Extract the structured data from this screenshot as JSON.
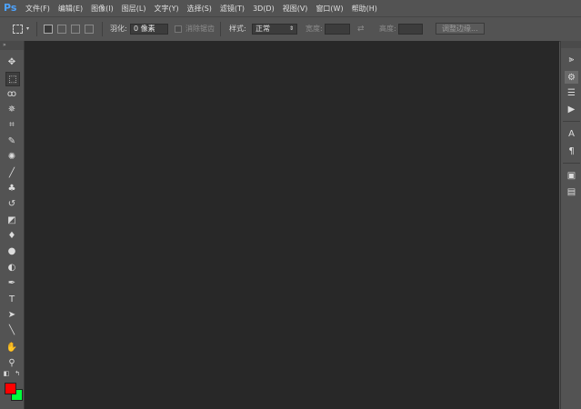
{
  "app": {
    "logo": "Ps"
  },
  "menu": [
    "文件(F)",
    "编辑(E)",
    "图像(I)",
    "图层(L)",
    "文字(Y)",
    "选择(S)",
    "滤镜(T)",
    "3D(D)",
    "视图(V)",
    "窗口(W)",
    "帮助(H)"
  ],
  "options": {
    "feather_label": "羽化:",
    "feather_value": "0 像素",
    "antialias_label": "消除锯齿",
    "style_label": "样式:",
    "style_value": "正常",
    "width_label": "宽度:",
    "height_label": "高度:",
    "refine_edge": "调整边缘..."
  },
  "tools": [
    {
      "name": "move-tool-icon",
      "glyph": "✥"
    },
    {
      "name": "rect-marquee-tool-icon",
      "glyph": "⬚"
    },
    {
      "name": "lasso-tool-icon",
      "glyph": "ꝏ"
    },
    {
      "name": "quick-select-tool-icon",
      "glyph": "✵"
    },
    {
      "name": "crop-tool-icon",
      "glyph": "⌗"
    },
    {
      "name": "eyedropper-tool-icon",
      "glyph": "✎"
    },
    {
      "name": "spot-heal-tool-icon",
      "glyph": "✺"
    },
    {
      "name": "brush-tool-icon",
      "glyph": "╱"
    },
    {
      "name": "clone-stamp-tool-icon",
      "glyph": "♣"
    },
    {
      "name": "history-brush-tool-icon",
      "glyph": "↺"
    },
    {
      "name": "eraser-tool-icon",
      "glyph": "◩"
    },
    {
      "name": "paint-bucket-tool-icon",
      "glyph": "♦"
    },
    {
      "name": "blur-tool-icon",
      "glyph": "●"
    },
    {
      "name": "dodge-tool-icon",
      "glyph": "◐"
    },
    {
      "name": "pen-tool-icon",
      "glyph": "✒"
    },
    {
      "name": "type-tool-icon",
      "glyph": "T"
    },
    {
      "name": "path-select-tool-icon",
      "glyph": "➤"
    },
    {
      "name": "line-tool-icon",
      "glyph": "╲"
    },
    {
      "name": "hand-tool-icon",
      "glyph": "✋"
    },
    {
      "name": "zoom-tool-icon",
      "glyph": "⚲"
    }
  ],
  "colors": {
    "foreground": "#ff0000",
    "background": "#00ff3c",
    "canvas": "#282828",
    "chrome": "#535353"
  },
  "right_panel": [
    {
      "name": "history-panel-icon",
      "glyph": "⫸"
    },
    {
      "name": "adjustments-panel-icon",
      "glyph": "⚙"
    },
    {
      "name": "properties-panel-icon",
      "glyph": "☰"
    },
    {
      "name": "actions-panel-icon",
      "glyph": "▶"
    },
    {
      "name": "character-panel-icon",
      "glyph": "A"
    },
    {
      "name": "paragraph-panel-icon",
      "glyph": "¶"
    },
    {
      "name": "layers-panel-icon",
      "glyph": "▣"
    },
    {
      "name": "notes-panel-icon",
      "glyph": "▤"
    }
  ]
}
